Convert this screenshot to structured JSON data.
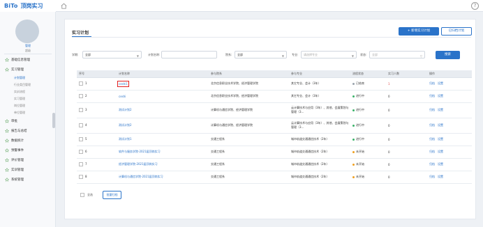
{
  "app": {
    "logo_mark": "BiTo",
    "logo_text": "顶岗实习"
  },
  "user": {
    "name": "管理",
    "role": "超级"
  },
  "sidebar": {
    "items": [
      {
        "label": "基础信息管理"
      },
      {
        "label": "实习管理",
        "sub": [
          "计划管理",
          "行业类目管理",
          "实训流程",
          "实习管理",
          "岗位管理",
          "单位管理"
        ]
      },
      {
        "label": "审批"
      },
      {
        "label": "报告与总结"
      },
      {
        "label": "数据统计"
      },
      {
        "label": "预警事件"
      },
      {
        "label": "评价管理"
      },
      {
        "label": "实训管理"
      },
      {
        "label": "系统管理"
      }
    ]
  },
  "panel": {
    "title": "实习计划",
    "new_button": "+ 新增实习计划",
    "archive_button": "已归档计划"
  },
  "filters": {
    "year_label": "学期:",
    "year_value": "全部",
    "name_label": "计划名称:",
    "name_value": "",
    "dept_label": "院系:",
    "dept_value": "全部",
    "major_label": "专业:",
    "major_placeholder": "请选择专业",
    "status_label": "状态:",
    "status_placeholder": "全部",
    "search_button": "搜索"
  },
  "table": {
    "headers": [
      "序号",
      "计划名称",
      "参与院系",
      "参与专业",
      "流程状态",
      "实习人数",
      "操作"
    ],
    "rows": [
      {
        "no": "1",
        "name": "ceshi1",
        "dept": "北京信息职业技术学院、经济管理学院",
        "major": "其它专业、会计（3年）",
        "status": "已结束",
        "status_color": "#9aa3ad",
        "count": "1",
        "count_red": true,
        "highlight": true,
        "tall": false
      },
      {
        "no": "2",
        "name": "ceshi",
        "dept": "北京信息职业技术学院、经济管理学院",
        "major": "其它专业、会计（3年）",
        "status": "进行中",
        "status_color": "#3bb36a",
        "count": "0",
        "count_red": false,
        "highlight": false,
        "tall": false
      },
      {
        "no": "3",
        "name": "测试计划2",
        "dept": "计算机与通信学院、经济管理学院",
        "major": "云计算技术与应用（3年）、其他、会展策划与管理（3...",
        "status": "进行中",
        "status_color": "#3bb36a",
        "count": "0",
        "count_red": false,
        "highlight": false,
        "tall": true
      },
      {
        "no": "4",
        "name": "测试计划2",
        "dept": "计算机与通信学院、经济管理学院",
        "major": "云计算技术与应用（3年）、其他、会展策划与管理（3...",
        "status": "进行中",
        "status_color": "#3bb36a",
        "count": "0",
        "count_red": false,
        "highlight": false,
        "tall": true
      },
      {
        "no": "5",
        "name": "测试计划1",
        "dept": "交通工程系",
        "major": "城市轨道交通通信技术（2年）",
        "status": "进行中",
        "status_color": "#3bb36a",
        "count": "0",
        "count_red": false,
        "highlight": false,
        "tall": false
      },
      {
        "no": "6",
        "name": "软件与服务学院-2021届顶岗实习",
        "dept": "交通工程系",
        "major": "城市轨道交通通信技术（2年）",
        "status": "未开始",
        "status_color": "#f0a020",
        "count": "0",
        "count_red": false,
        "highlight": false,
        "tall": false
      },
      {
        "no": "7",
        "name": "经济管理学院-2021届顶岗实习",
        "dept": "交通工程系",
        "major": "城市轨道交通通信技术（2年）",
        "status": "未开始",
        "status_color": "#f0a020",
        "count": "0",
        "count_red": false,
        "highlight": false,
        "tall": false
      },
      {
        "no": "8",
        "name": "计算机与通信学院-2021届顶岗实习",
        "dept": "交通工程系",
        "major": "城市轨道交通通信技术（2年）",
        "status": "未开始",
        "status_color": "#f0a020",
        "count": "0",
        "count_red": false,
        "highlight": false,
        "tall": false
      }
    ],
    "actions": [
      "归档",
      "设置"
    ]
  },
  "footer": {
    "select_all": "全选",
    "batch_button": "批量归档"
  }
}
